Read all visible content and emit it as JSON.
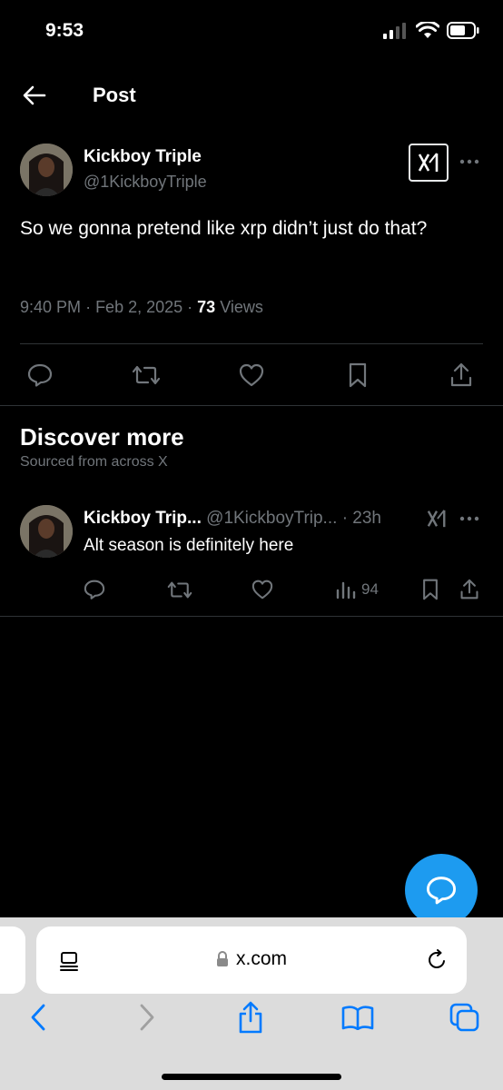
{
  "status_bar": {
    "time": "9:53"
  },
  "header": {
    "title": "Post"
  },
  "post": {
    "author_name": "Kickboy Triple",
    "author_handle": "@1KickboyTriple",
    "text": "So we gonna pretend like xrp didn’t just do that?",
    "time": "9:40 PM",
    "date": "Feb 2, 2025",
    "views_count": "73",
    "views_label": "Views"
  },
  "discover": {
    "title": "Discover more",
    "subtitle": "Sourced from across X"
  },
  "reply": {
    "author_name": "Kickboy Trip...",
    "author_handle": "@1KickboyTrip...",
    "time": "· 23h",
    "text": "Alt season is definitely here",
    "views": "94"
  },
  "browser": {
    "url": "x.com"
  },
  "colors": {
    "accent": "#1d9bf0",
    "muted": "#71767b",
    "divider": "#2f3336"
  }
}
